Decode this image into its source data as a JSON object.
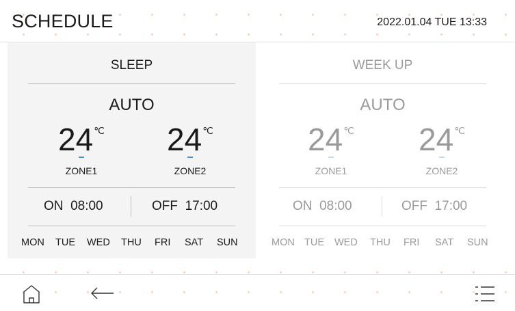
{
  "header": {
    "title": "SCHEDULE",
    "datetime": "2022.01.04 TUE 13:33"
  },
  "cards": [
    {
      "mode": "SLEEP",
      "operation": "AUTO",
      "zones": [
        {
          "temp": "24",
          "unit": "℃",
          "label": "ZONE1"
        },
        {
          "temp": "24",
          "unit": "℃",
          "label": "ZONE2"
        }
      ],
      "on_label": "ON",
      "on_time": "08:00",
      "off_label": "OFF",
      "off_time": "17:00",
      "days": [
        "MON",
        "TUE",
        "WED",
        "THU",
        "FRI",
        "SAT",
        "SUN"
      ]
    },
    {
      "mode": "WEEK UP",
      "operation": "AUTO",
      "zones": [
        {
          "temp": "24",
          "unit": "℃",
          "label": "ZONE1"
        },
        {
          "temp": "24",
          "unit": "℃",
          "label": "ZONE2"
        }
      ],
      "on_label": "ON",
      "on_time": "08:00",
      "off_label": "OFF",
      "off_time": "17:00",
      "days": [
        "MON",
        "TUE",
        "WED",
        "THU",
        "FRI",
        "SAT",
        "SUN"
      ]
    }
  ],
  "footer": {
    "home_icon": "home-icon",
    "back_icon": "back-arrow-icon",
    "menu_icon": "menu-list-icon"
  },
  "colors": {
    "accent": "#4a90e2",
    "active_card_bg": "#f4f4f4",
    "inactive_text": "#9a9a9a",
    "dot_pattern": "#f2cdb8"
  }
}
